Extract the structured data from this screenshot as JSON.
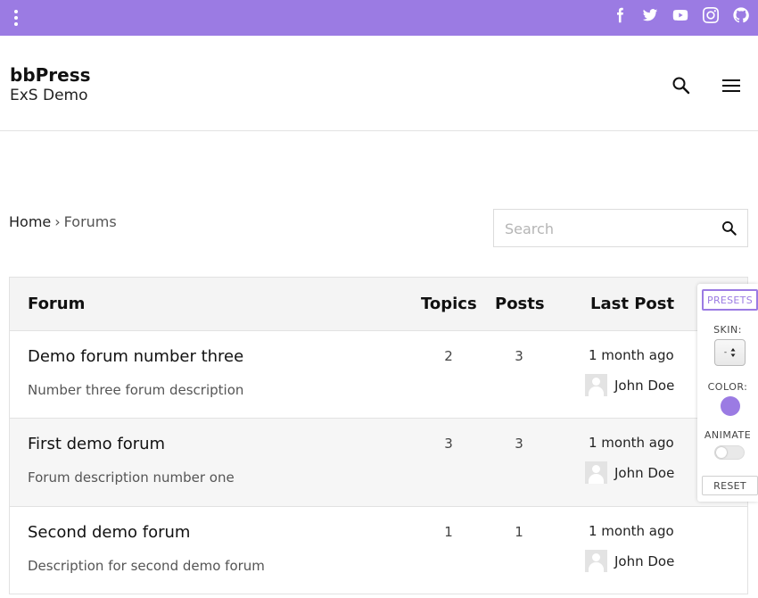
{
  "colors": {
    "accent": "#9b7be3",
    "text": "#111111",
    "muted": "#555555",
    "border": "#e2e2e2"
  },
  "topbar": {
    "menu_icon": "vertical-dots-icon",
    "social_icons": [
      "facebook-icon",
      "twitter-icon",
      "youtube-icon",
      "instagram-icon",
      "github-icon"
    ]
  },
  "header": {
    "site_title": "bbPress",
    "site_description": "ExS Demo",
    "search_icon": "search-icon",
    "menu_icon": "hamburger-menu-icon"
  },
  "breadcrumb": {
    "home": "Home",
    "separator": "›",
    "current": "Forums"
  },
  "search": {
    "placeholder": "Search",
    "value": ""
  },
  "table": {
    "headers": {
      "forum": "Forum",
      "topics": "Topics",
      "posts": "Posts",
      "last_post": "Last Post"
    },
    "rows": [
      {
        "title": "Demo forum number three",
        "description": "Number three forum description",
        "topics": "2",
        "posts": "3",
        "freshness": "1 month ago",
        "author": "John Doe"
      },
      {
        "title": "First demo forum",
        "description": "Forum description number one",
        "topics": "3",
        "posts": "3",
        "freshness": "1 month ago",
        "author": "John Doe"
      },
      {
        "title": "Second demo forum",
        "description": "Description for second demo forum",
        "topics": "1",
        "posts": "1",
        "freshness": "1 month ago",
        "author": "John Doe"
      }
    ]
  },
  "customizer": {
    "presets_label": "PRESETS",
    "skin_label": "SKIN:",
    "skin_value": "-",
    "color_label": "COLOR:",
    "color_value": "#9b7be3",
    "animate_label": "ANIMATE",
    "animate_on": false,
    "reset_label": "RESET"
  }
}
